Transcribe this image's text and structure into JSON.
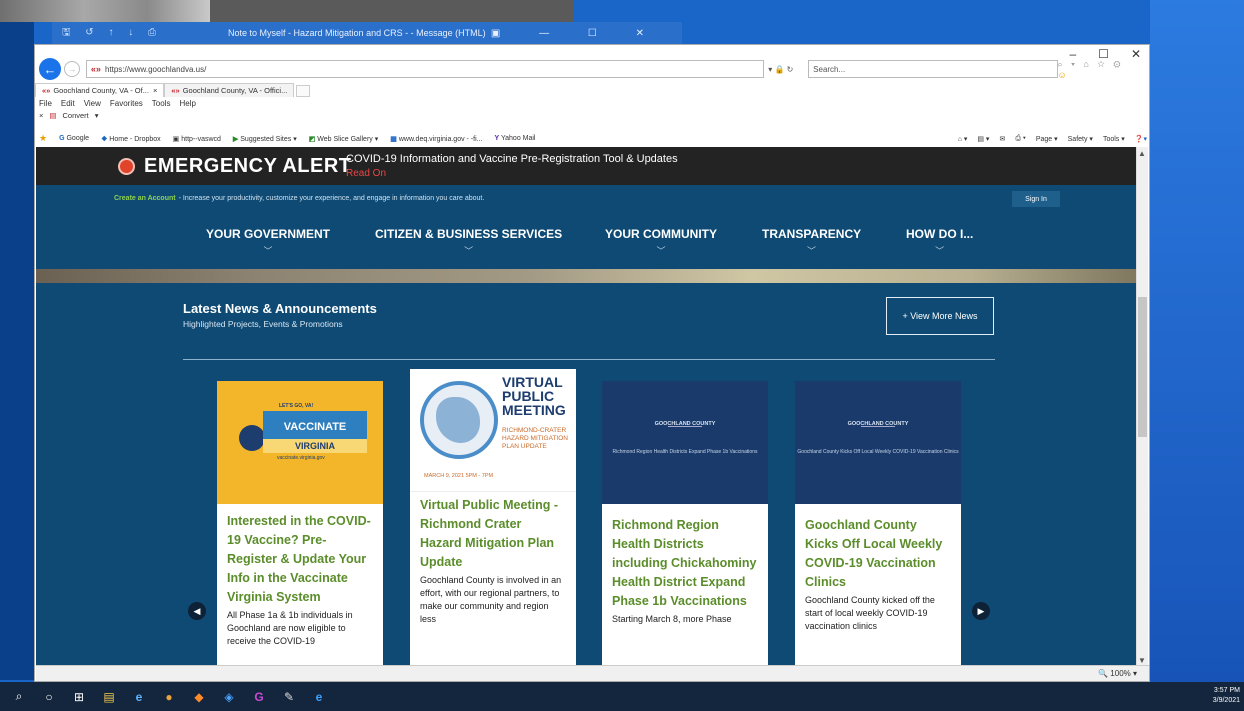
{
  "outlook": {
    "toolbar_icons": "🖫 ↺ ↑ ↓ ⎙",
    "title": "Note to Myself - Hazard Mitigation and CRS - - Message (HTML)",
    "controls": "▣ — ☐ ✕"
  },
  "browser": {
    "window_controls": {
      "min": "–",
      "max": "☐",
      "close": "✕"
    },
    "url": "https://www.goochlandva.us/",
    "url_tools": "▾ 🔒 ↻",
    "search_placeholder": "Search...",
    "right_tools": "⌕ ▾",
    "tabs": [
      {
        "label": "Goochland County, VA - Of...",
        "close": "×"
      },
      {
        "label": "Goochland County, VA - Offici..."
      }
    ],
    "menu": [
      "File",
      "Edit",
      "View",
      "Favorites",
      "Tools",
      "Help"
    ],
    "convert_label": "Convert",
    "favorites": [
      "Google",
      "Home - Dropbox",
      "http--vaswcd",
      "Suggested Sites ▾",
      "Web Slice Gallery ▾",
      "www.deq.virginia.gov - -fi...",
      "Yahoo Mail"
    ],
    "command_bar": [
      "Page ▾",
      "Safety ▾",
      "Tools ▾"
    ],
    "zoom": "🔍 100%  ▾"
  },
  "page": {
    "alert": {
      "title": "EMERGENCY ALERT",
      "message": "COVID-19 Information and Vaccine Pre-Registration Tool & Updates",
      "link": "Read On"
    },
    "account": {
      "link": "Create an Account",
      "text": "- Increase your productivity, customize your experience, and engage in information you care about.",
      "sign_in": "Sign In"
    },
    "nav": [
      {
        "label": "YOUR GOVERNMENT"
      },
      {
        "label": "CITIZEN & BUSINESS SERVICES"
      },
      {
        "label": "YOUR COMMUNITY"
      },
      {
        "label": "TRANSPARENCY"
      },
      {
        "label": "HOW DO I..."
      }
    ],
    "news": {
      "title": "Latest News & Announcements",
      "subtitle": "Highlighted Projects, Events & Promotions",
      "view_more": "+ View More News"
    },
    "cards": [
      {
        "img": {
          "tag": "LET'S GO, VA!",
          "flag1": "VACCINATE",
          "flag2": "VIRGINIA",
          "small": "vaccinate.virginia.gov"
        },
        "title": "Interested in the COVID-19 Vaccine? Pre-Register & Update Your Info in the Vaccinate Virginia System",
        "body": "All Phase 1a & 1b individuals in Goochland are now eligible to receive the COVID-19"
      },
      {
        "img": {
          "title": "VIRTUAL PUBLIC MEETING",
          "sub": "RICHMOND-CRATER HAZARD MITIGATION PLAN UPDATE",
          "date": "MARCH 9, 2021  5PM - 7PM"
        },
        "title": "Virtual Public Meeting - Richmond Crater Hazard Mitigation Plan Update",
        "body": "Goochland County is involved in an effort, with our regional partners, to make our community and region less"
      },
      {
        "img": {
          "county": "GOOCHLAND COUNTY",
          "line": "Richmond Region Health Districts Expand Phase 1b Vaccinations"
        },
        "title": "Richmond Region Health Districts including Chickahominy Health District Expand Phase 1b Vaccinations",
        "body": "Starting March 8, more Phase"
      },
      {
        "img": {
          "county": "GOOCHLAND COUNTY",
          "line": "Goochland County Kicks Off Local Weekly COVID-19 Vaccination Clinics"
        },
        "title": "Goochland County Kicks Off Local Weekly COVID-19 Vaccination Clinics",
        "body": "Goochland County kicked off the start of local weekly COVID-19 vaccination clinics"
      }
    ]
  },
  "taskbar": {
    "items": [
      "⌕",
      "○",
      "⊞",
      "▤",
      "e",
      "●",
      "◆",
      "◈",
      "G",
      "✎",
      "e"
    ],
    "time": "3:57 PM",
    "date": "3/9/2021"
  }
}
